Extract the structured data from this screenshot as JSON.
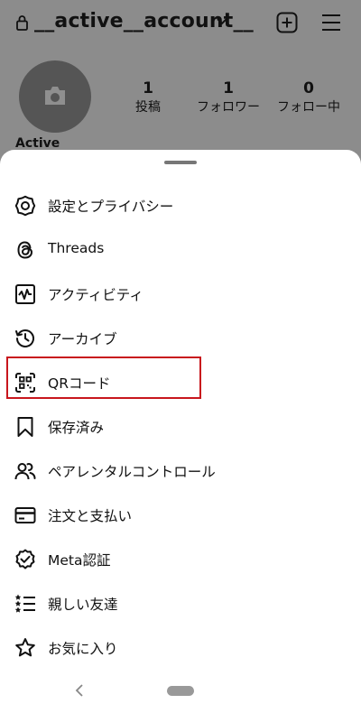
{
  "header": {
    "username": "__active__account__",
    "lock_icon": "lock-icon",
    "dropdown_icon": "chevron-down-icon",
    "create_icon": "plus-square-icon",
    "menu_icon": "hamburger-menu-icon"
  },
  "profile": {
    "display_name": "Active",
    "stats": [
      {
        "value": "1",
        "label": "投稿"
      },
      {
        "value": "1",
        "label": "フォロワー"
      },
      {
        "value": "0",
        "label": "フォロー中"
      }
    ]
  },
  "sheet": {
    "items": [
      {
        "label": "設定とプライバシー",
        "icon": "settings-gear-icon"
      },
      {
        "label": "Threads",
        "icon": "threads-icon"
      },
      {
        "label": "アクティビティ",
        "icon": "activity-icon"
      },
      {
        "label": "アーカイブ",
        "icon": "archive-history-icon"
      },
      {
        "label": "QRコード",
        "icon": "qr-code-icon"
      },
      {
        "label": "保存済み",
        "icon": "bookmark-icon"
      },
      {
        "label": "ペアレンタルコントロール",
        "icon": "parental-controls-icon"
      },
      {
        "label": "注文と支払い",
        "icon": "credit-card-icon"
      },
      {
        "label": "Meta認証",
        "icon": "verified-badge-icon"
      },
      {
        "label": "親しい友達",
        "icon": "close-friends-list-icon"
      },
      {
        "label": "お気に入り",
        "icon": "star-icon"
      }
    ],
    "highlight_color": "#c8161d"
  }
}
